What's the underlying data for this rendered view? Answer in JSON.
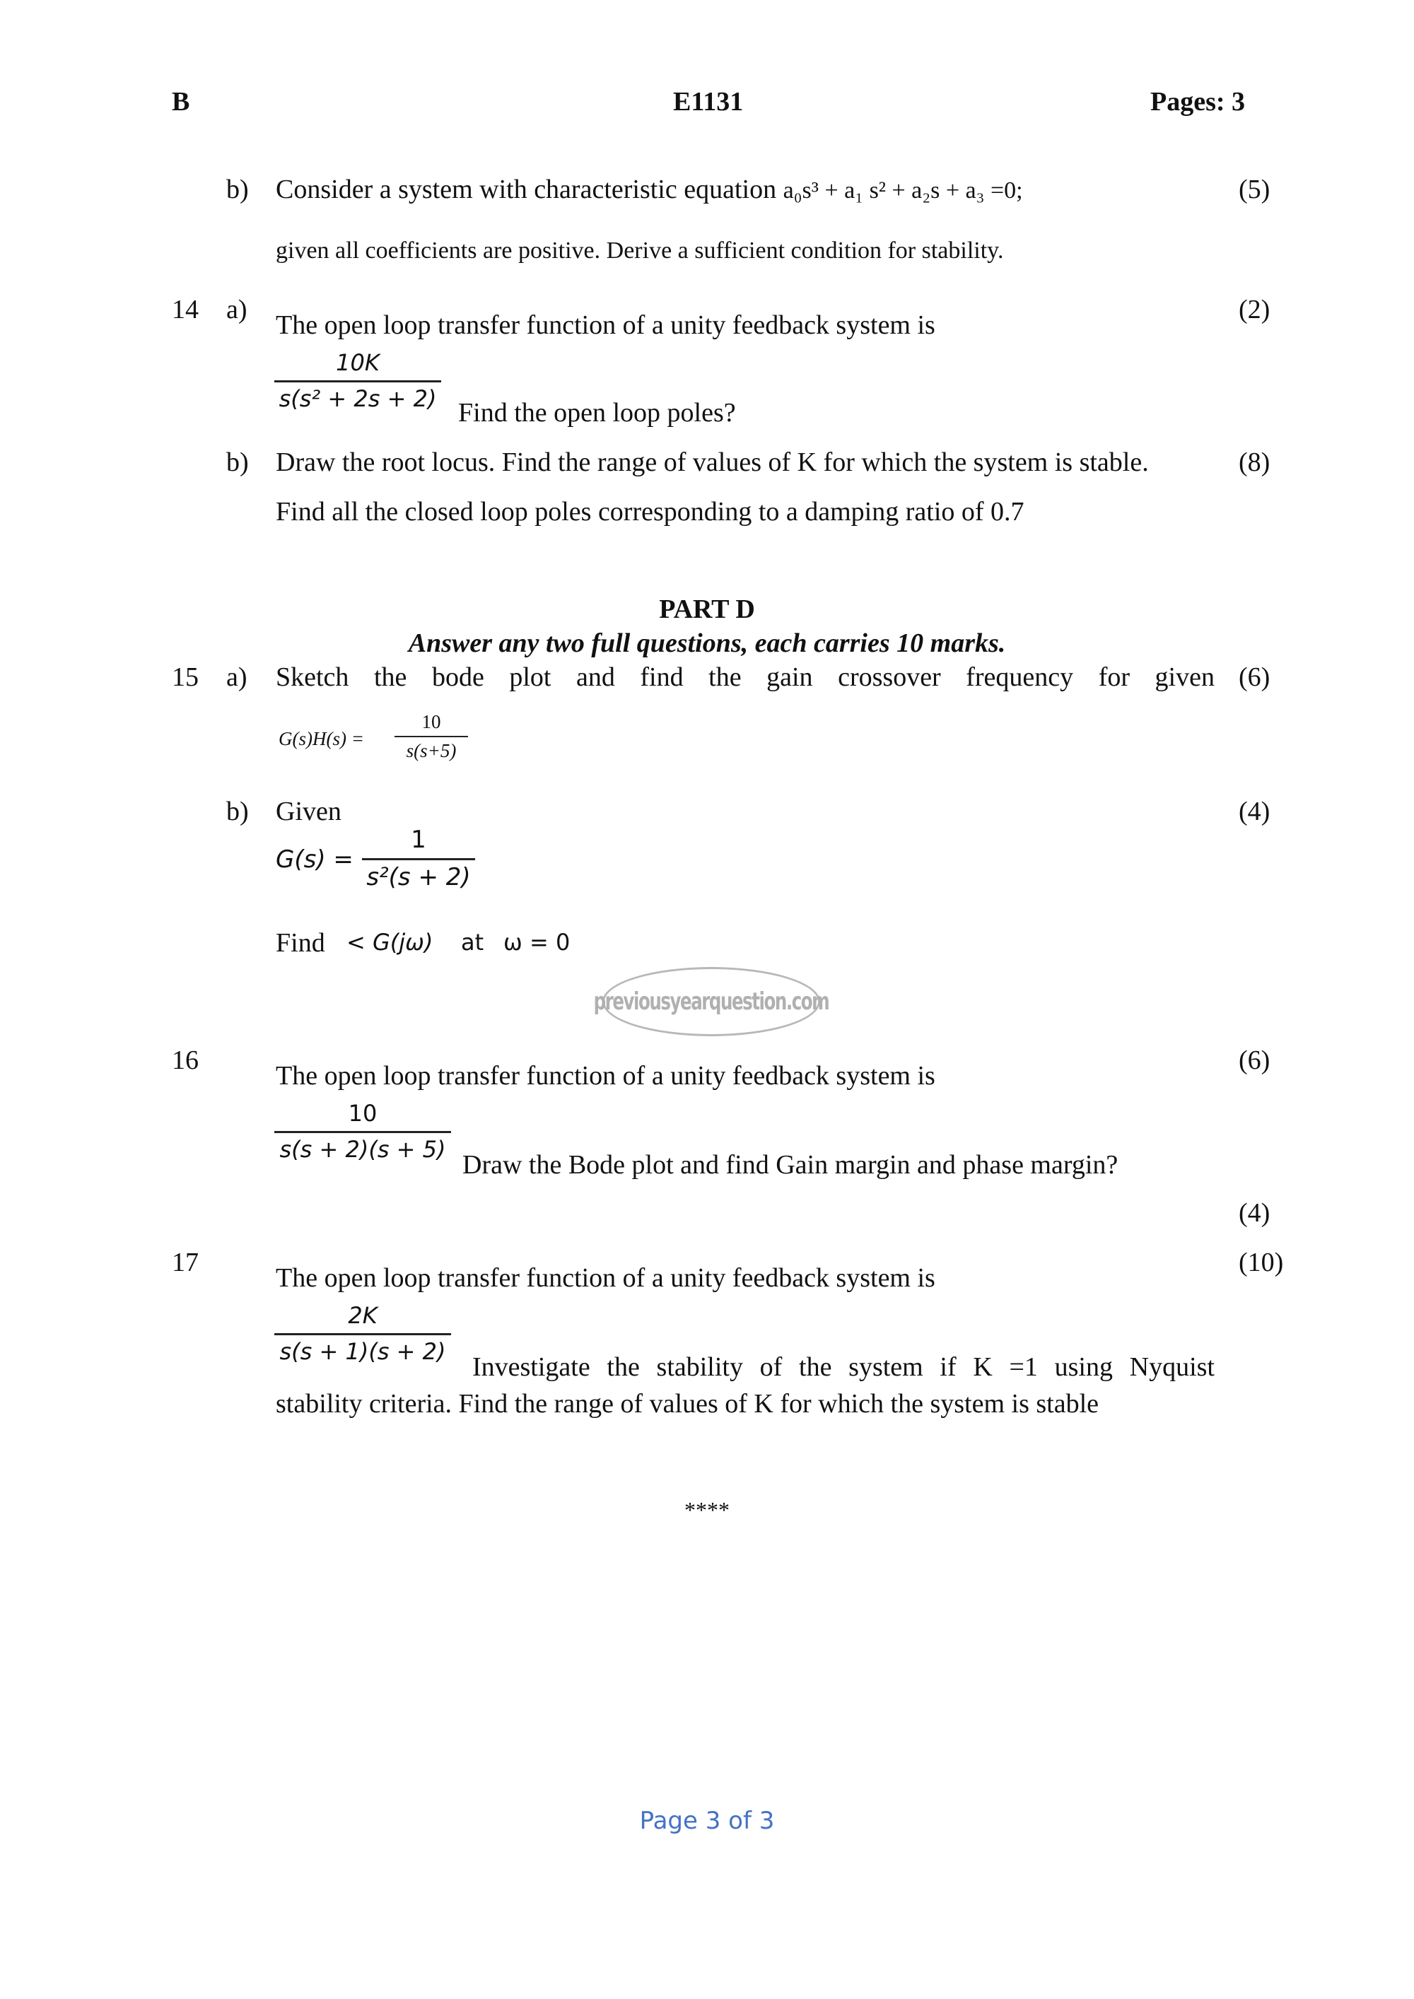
{
  "header": {
    "set": "B",
    "code": "E1131",
    "pages": "Pages: 3"
  },
  "q13b": {
    "label": "b)",
    "line1_prefix": "Consider a system with characteristic equation ",
    "equation": "a₀s³ + a₁ s² + a₂s + a₃ =0;",
    "line2": "given all coefficients are positive. Derive a sufficient condition for stability.",
    "marks": "(5)"
  },
  "q14": {
    "number": "14",
    "a": {
      "label": "a)",
      "intro": "The open loop transfer function of a unity feedback system is",
      "numerator": "10K",
      "denominator": "s(s² + 2s + 2)",
      "question": "Find the open loop poles?",
      "marks": "(2)"
    },
    "b": {
      "label": "b)",
      "line1": "Draw the root locus. Find the range of values of K for which the system is stable.",
      "line2": "Find all the closed loop poles corresponding to a damping ratio of 0.7",
      "marks": "(8)"
    }
  },
  "part_d": {
    "title": "PART D",
    "instruction": "Answer any two full questions, each carries 10 marks."
  },
  "q15": {
    "number": "15",
    "a": {
      "label": "a)",
      "words": [
        "Sketch",
        "the",
        "bode",
        "plot",
        "and",
        "find",
        "the",
        "gain",
        "crossover",
        "frequency",
        "for",
        "given"
      ],
      "lhs": "G(s)H(s) =",
      "numerator": "10",
      "denominator": "s(s+5)",
      "marks": "(6)"
    },
    "b": {
      "label": "b)",
      "given": "Given",
      "lhs": "G(s) =",
      "numerator": "1",
      "denominator": "s²(s + 2)",
      "find": "Find",
      "find_expr": "< G(jω)",
      "at": "at",
      "condition": "ω = 0",
      "marks": "(4)"
    }
  },
  "watermark": "previousyearquestion.com",
  "q16": {
    "number": "16",
    "intro": "The open loop transfer function of a unity feedback system is",
    "numerator": "10",
    "denominator": "s(s + 2)(s + 5)",
    "question": "Draw the Bode plot and find Gain margin and phase margin?",
    "marks": "(6)",
    "extra_marks": "(4)"
  },
  "q17": {
    "number": "17",
    "intro": "The open loop transfer function of a unity feedback system is",
    "numerator": "2K",
    "denominator": "s(s + 1)(s + 2)",
    "question_line1": "Investigate the stability of the system if K =1 using Nyquist",
    "question_line2": "stability criteria. Find the range of values of K for which the system is stable",
    "marks": "(10)"
  },
  "end_marker": "****",
  "footer": {
    "page_label": "Page 3 of 3",
    "color": "#4472c4"
  }
}
